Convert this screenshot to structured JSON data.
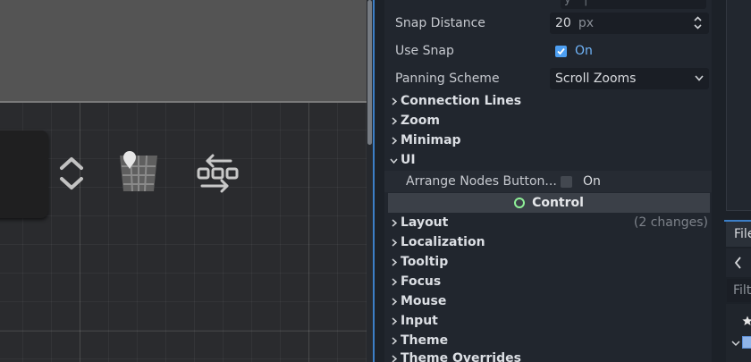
{
  "inspector": {
    "snap_distance": {
      "label": "Snap Distance",
      "value": "20",
      "unit": "px"
    },
    "use_snap": {
      "label": "Use Snap",
      "value": "On",
      "checked": true
    },
    "panning_scheme": {
      "label": "Panning Scheme",
      "value": "Scroll Zooms"
    },
    "sections_before": [
      {
        "label": "Connection Lines"
      },
      {
        "label": "Zoom"
      },
      {
        "label": "Minimap"
      }
    ],
    "ui_section": {
      "label": "UI",
      "expanded": true
    },
    "arrange_nodes": {
      "label": "Arrange Nodes Button...",
      "value": "On",
      "checked": false
    },
    "class_header": "Control",
    "sections_after": [
      {
        "label": "Layout",
        "changes": "(2 changes)"
      },
      {
        "label": "Localization"
      },
      {
        "label": "Tooltip"
      },
      {
        "label": "Focus"
      },
      {
        "label": "Mouse"
      },
      {
        "label": "Input"
      },
      {
        "label": "Theme"
      },
      {
        "label": "Theme Overrides"
      }
    ]
  },
  "right_dock": {
    "tab_label": "File",
    "filter_placeholder": "Filt"
  },
  "colors": {
    "accent": "#4d9ff2",
    "class_icon": "#8eef97",
    "panel_bg": "#21262e"
  }
}
